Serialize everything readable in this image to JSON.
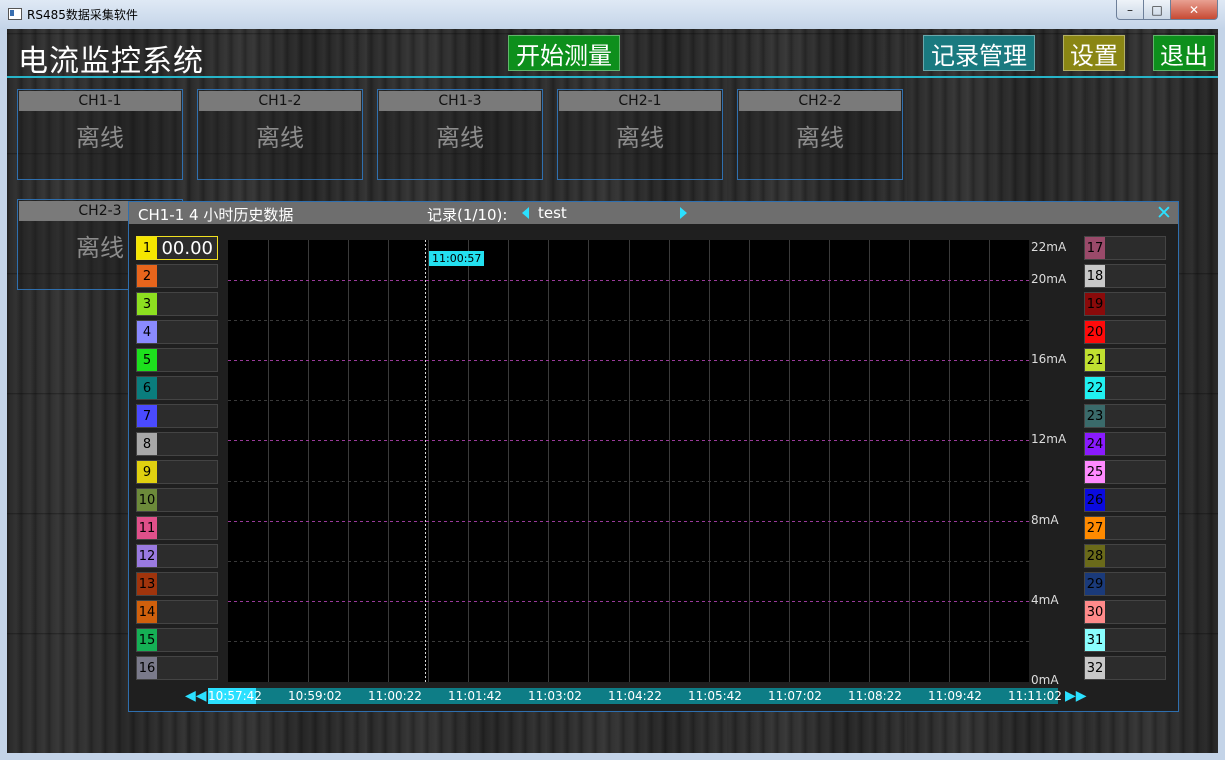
{
  "window": {
    "title": "RS485数据采集软件",
    "min": "–",
    "max": "□",
    "close": "✕"
  },
  "app": {
    "title": "电流监控系统",
    "buttons": {
      "start": "开始测量",
      "records": "记录管理",
      "settings": "设置",
      "exit": "退出"
    }
  },
  "cards": [
    {
      "name": "CH1-1",
      "status": "离线"
    },
    {
      "name": "CH1-2",
      "status": "离线"
    },
    {
      "name": "CH1-3",
      "status": "离线"
    },
    {
      "name": "CH2-1",
      "status": "离线"
    },
    {
      "name": "CH2-2",
      "status": "离线"
    },
    {
      "name": "CH2-3",
      "status": "离线"
    }
  ],
  "panel": {
    "title": "CH1-1  4 小时历史数据",
    "record_label": "记录(1/10):",
    "record_name": "test",
    "close": "✕",
    "active_value": "00.00",
    "cursor_time": "11:00:57",
    "y_axis": [
      "22mA",
      "20mA",
      "16mA",
      "12mA",
      "8mA",
      "4mA",
      "0mA"
    ],
    "x_axis": [
      "10:57:42",
      "10:59:02",
      "11:00:22",
      "11:01:42",
      "11:03:02",
      "11:04:22",
      "11:05:42",
      "11:07:02",
      "11:08:22",
      "11:09:42",
      "11:11:02"
    ],
    "nav_left": "◀◀",
    "nav_right": "▶▶"
  },
  "channels": [
    {
      "label": "1",
      "color": "#f5e600"
    },
    {
      "label": "2",
      "color": "#e8651c"
    },
    {
      "label": "3",
      "color": "#8de020"
    },
    {
      "label": "4",
      "color": "#8a8aff"
    },
    {
      "label": "5",
      "color": "#1de01d"
    },
    {
      "label": "6",
      "color": "#0a7d7d"
    },
    {
      "label": "7",
      "color": "#4a4aff"
    },
    {
      "label": "8",
      "color": "#a8a8a8"
    },
    {
      "label": "9",
      "color": "#e0d010"
    },
    {
      "label": "10",
      "color": "#6c8a3a"
    },
    {
      "label": "11",
      "color": "#e0508a"
    },
    {
      "label": "12",
      "color": "#9a7ae0"
    },
    {
      "label": "13",
      "color": "#a0340c"
    },
    {
      "label": "14",
      "color": "#d0600c"
    },
    {
      "label": "15",
      "color": "#15b055"
    },
    {
      "label": "16",
      "color": "#7a7a8a"
    },
    {
      "label": "17",
      "color": "#9a4a6a"
    },
    {
      "label": "18",
      "color": "#c8c8c8"
    },
    {
      "label": "19",
      "color": "#8a0a0a"
    },
    {
      "label": "20",
      "color": "#ff0a0a"
    },
    {
      "label": "21",
      "color": "#c0e030"
    },
    {
      "label": "22",
      "color": "#20f0f0"
    },
    {
      "label": "23",
      "color": "#3a6a6a"
    },
    {
      "label": "24",
      "color": "#8a1aff"
    },
    {
      "label": "25",
      "color": "#ff8aff"
    },
    {
      "label": "26",
      "color": "#0a0ae0"
    },
    {
      "label": "27",
      "color": "#ff8a00"
    },
    {
      "label": "28",
      "color": "#6a6a1a"
    },
    {
      "label": "29",
      "color": "#1a3a7a"
    },
    {
      "label": "30",
      "color": "#ff8a8a"
    },
    {
      "label": "31",
      "color": "#8affff"
    },
    {
      "label": "32",
      "color": "#c8c8c8"
    }
  ],
  "chart_data": {
    "type": "line",
    "ylim": [
      0,
      22
    ],
    "y_ticks": [
      "0mA",
      "4mA",
      "8mA",
      "12mA",
      "16mA",
      "20mA",
      "22mA"
    ],
    "x_ticks": [
      "10:57:42",
      "10:59:02",
      "11:00:22",
      "11:01:42",
      "11:03:02",
      "11:04:22",
      "11:05:42",
      "11:07:02",
      "11:08:22",
      "11:09:42",
      "11:11:02"
    ],
    "series": [],
    "grid": true,
    "cursor_time": "11:00:57"
  }
}
